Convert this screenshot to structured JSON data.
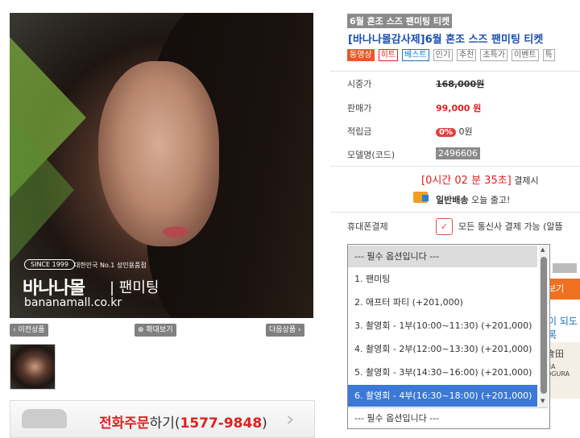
{
  "image": {
    "since": "SINCE 1999",
    "tagline": "대한민국 No.1 성인용품점",
    "brand_logo": "바나나몰",
    "brand_sub": "| 팬미팅",
    "brand_url": "bananamall.co.kr"
  },
  "image_nav": {
    "prev": "‹ 이전상품",
    "zoom": "⊕ 확대보기",
    "next": "다음상품 ›"
  },
  "phone": {
    "highlight": "전화주문",
    "rest": "하기(",
    "number": "1577-9848",
    "close": ")"
  },
  "product": {
    "category": "6월 혼조 스즈 팬미팅 티켓",
    "title": "[바나나몰감사제]6월 혼조 스즈 팬미팅 티켓",
    "tags": [
      "동영상",
      "히트",
      "베스트",
      "인기",
      "추천",
      "초특가",
      "이벤트",
      "특"
    ]
  },
  "details": {
    "list_price_label": "시중가",
    "list_price": "168,000원",
    "sale_price_label": "판매가",
    "sale_price": "99,000 원",
    "points_label": "적립금",
    "points_pct": "0%",
    "points_value": "0원",
    "model_label": "모델명(코드)",
    "model_code": "2496606"
  },
  "timer": {
    "open": "[",
    "countdown": "0시간 02 분 35초",
    "close": "]",
    "suffix": " 결제시"
  },
  "shipping": {
    "type": "일반배송",
    "text": " 오늘 출고!"
  },
  "mobile": {
    "label": "휴대폰결제",
    "text": "모든 통신사 결제 가능 (알뜰"
  },
  "hidden_right": {
    "orange": "보기",
    "blue": "이 되도록",
    "banner_top": "倉田",
    "banner_mid": "NA OGURA"
  },
  "options": {
    "header": "--- 필수 옵션입니다 ---",
    "items": [
      "1. 팬미팅",
      "2. 애프터 파티 (+201,000)",
      "3. 촬영회 - 1부(10:00~11:30) (+201,000)",
      "4. 촬영회 - 2부(12:00~13:30) (+201,000)",
      "5. 촬영회 - 3부(14:30~16:00) (+201,000)",
      "6. 촬영회 - 4부(16:30~18:00) (+201,000)"
    ],
    "selected_index": 5,
    "current_value": "--- 필수 옵션입니다 ---"
  }
}
